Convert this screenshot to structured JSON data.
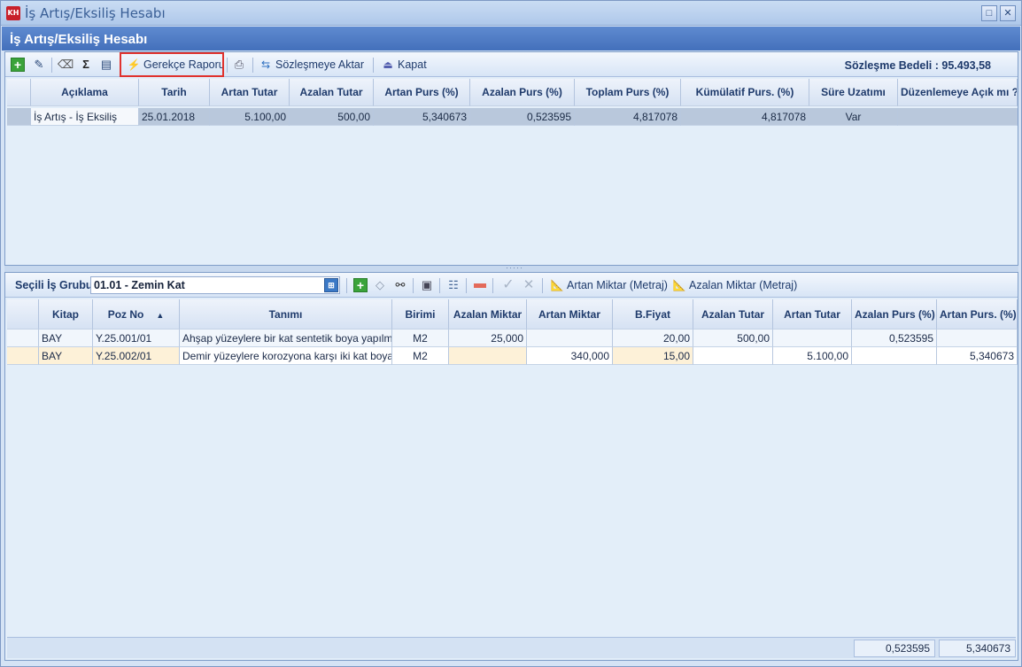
{
  "window": {
    "title": "İş Artış/Eksiliş Hesabı",
    "app_icon": "KH",
    "buttons": [
      "maximize-icon",
      "close-icon"
    ]
  },
  "header": {
    "title": "İş Artış/Eksiliş Hesabı"
  },
  "toolbar": {
    "icons": [
      "add-icon",
      "edit-icon",
      "erase-icon",
      "sum-icon",
      "document-icon"
    ],
    "gerekce_label": "Gerekçe Raporu",
    "print_icon": "print-icon",
    "sozlesme_label": "Sözleşmeye Aktar",
    "kapat_label": "Kapat",
    "contract_label": "Sözleşme Bedeli : 95.493,58"
  },
  "top_table": {
    "columns": [
      "Açıklama",
      "Tarih",
      "Artan Tutar",
      "Azalan Tutar",
      "Artan Purs (%)",
      "Azalan Purs (%)",
      "Toplam Purs (%)",
      "Kümülatif Purs. (%)",
      "Süre Uzatımı",
      "Düzenlemeye Açık mı ?"
    ],
    "rows": [
      [
        "İş Artış - İş Eksiliş",
        "25.01.2018",
        "5.100,00",
        "500,00",
        "5,340673",
        "0,523595",
        "4,817078",
        "4,817078",
        "Var",
        ""
      ]
    ]
  },
  "bottom": {
    "group_label": "Seçili İş Grubu",
    "group_value": "01.01 - Zemin Kat",
    "artan_miktar_label": "Artan Miktar (Metraj)",
    "azalan_miktar_label": "Azalan Miktar (Metraj)",
    "columns": [
      "Kitap",
      "Poz No",
      "Tanımı",
      "Birimi",
      "Azalan Miktar",
      "Artan Miktar",
      "B.Fiyat",
      "Azalan Tutar",
      "Artan Tutar",
      "Azalan Purs (%)",
      "Artan Purs. (%)"
    ],
    "rows": [
      [
        "BAY",
        "Y.25.001/01",
        "Ahşap yüzeylere bir kat sentetik boya yapılm",
        "M2",
        "25,000",
        "",
        "20,00",
        "500,00",
        "",
        "0,523595",
        ""
      ],
      [
        "BAY",
        "Y.25.002/01",
        "Demir yüzeylere korozyona karşı iki kat boya",
        "M2",
        "",
        "340,000",
        "15,00",
        "",
        "5.100,00",
        "",
        "5,340673"
      ]
    ],
    "footer": [
      "0,523595",
      "5,340673"
    ]
  }
}
